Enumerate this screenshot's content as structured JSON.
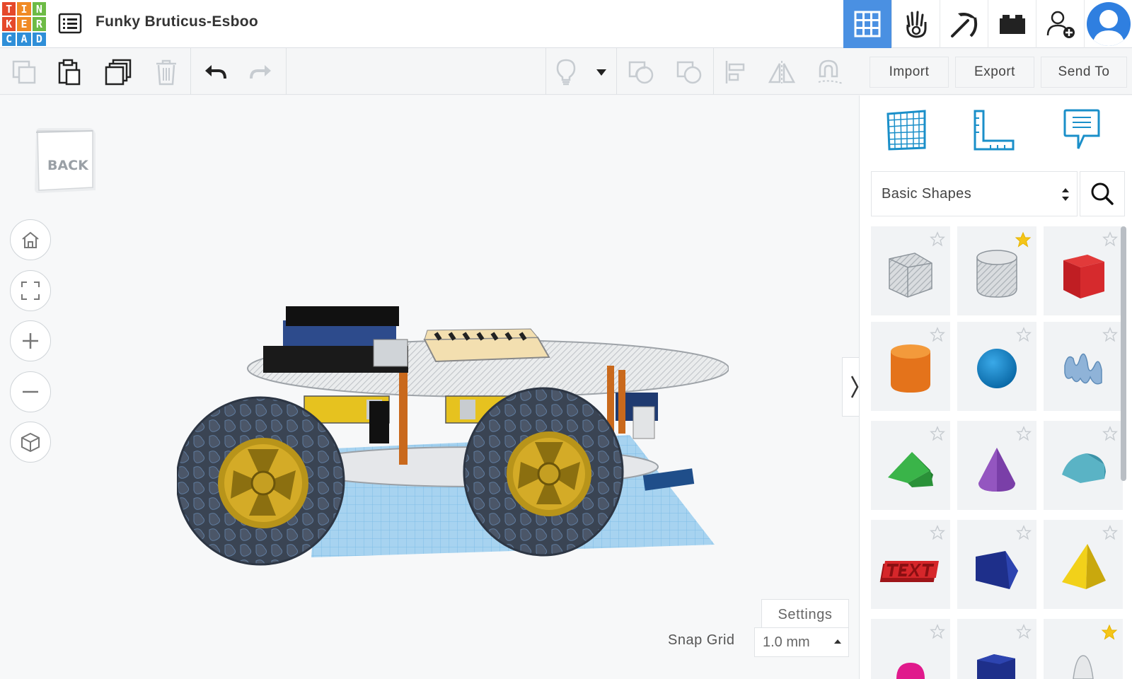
{
  "app": {
    "logo_letters": [
      "T",
      "I",
      "N",
      "K",
      "E",
      "R",
      "C",
      "A",
      "D"
    ],
    "logo_colors": [
      "#e5492b",
      "#f08a24",
      "#6dbb45",
      "#e5492b",
      "#f08a24",
      "#6dbb45",
      "#2f8fd8",
      "#2f8fd8",
      "#2f8fd8"
    ],
    "design_title": "Funky Bruticus-Esboo"
  },
  "header": {
    "icons": [
      "3d-design-grid-icon",
      "circuits-hand-icon",
      "codeblocks-pickaxe-icon",
      "brick-icon",
      "invite-user-icon",
      "user-avatar-icon"
    ],
    "accent": "#4a90e2"
  },
  "toolbar": {
    "tools": [
      "copy",
      "paste",
      "duplicate",
      "delete",
      "undo",
      "redo"
    ],
    "view_tools": [
      "light-bulb",
      "dropdown",
      "group",
      "ungroup",
      "align",
      "mirror",
      "magnet"
    ]
  },
  "actions": {
    "import_label": "Import",
    "export_label": "Export",
    "send_to_label": "Send To"
  },
  "viewcube": {
    "face_label": "BACK"
  },
  "workplane": {
    "settings_label": "Settings",
    "snap_grid_label": "Snap Grid",
    "snap_grid_value": "1.0 mm"
  },
  "panel": {
    "library_value": "Basic Shapes",
    "shapes": [
      {
        "name": "box-hole",
        "starred": false
      },
      {
        "name": "cylinder-hole",
        "starred": true
      },
      {
        "name": "box",
        "starred": false
      },
      {
        "name": "cylinder",
        "starred": false
      },
      {
        "name": "sphere",
        "starred": false
      },
      {
        "name": "scribble",
        "starred": false
      },
      {
        "name": "roof",
        "starred": false
      },
      {
        "name": "cone",
        "starred": false
      },
      {
        "name": "round-roof",
        "starred": false
      },
      {
        "name": "text",
        "starred": false
      },
      {
        "name": "polygon-prism",
        "starred": false
      },
      {
        "name": "pyramid",
        "starred": false
      },
      {
        "name": "half-sphere",
        "starred": false
      },
      {
        "name": "polygon",
        "starred": false
      },
      {
        "name": "paraboloid",
        "starred": true
      }
    ]
  }
}
